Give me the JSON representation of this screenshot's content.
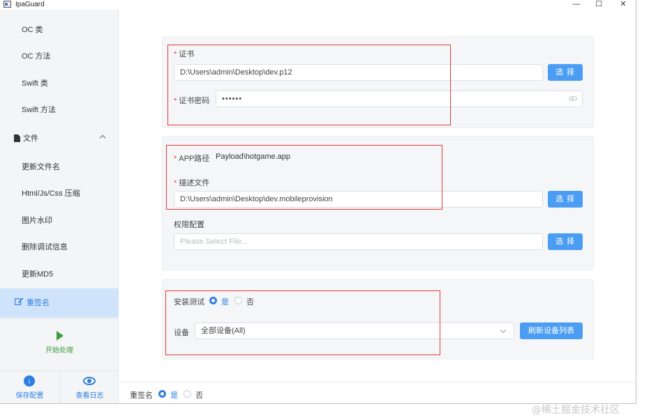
{
  "window": {
    "title": "IpaGuard",
    "minimize": "—",
    "maximize": "☐",
    "close": "✕"
  },
  "sidebar": {
    "items": [
      {
        "label": "OC 类"
      },
      {
        "label": "OC 方法"
      },
      {
        "label": "Swift 类"
      },
      {
        "label": "Swift 方法"
      }
    ],
    "file_section": {
      "label": "文件"
    },
    "file_items": [
      {
        "label": "更新文件名"
      },
      {
        "label": "Html/Js/Css 压缩"
      },
      {
        "label": "图片水印"
      },
      {
        "label": "删除调试信息"
      },
      {
        "label": "更新MD5"
      }
    ],
    "active_item": {
      "label": "重签名"
    },
    "start_label": "开始处理",
    "save_label": "保存配置",
    "log_label": "查看日志"
  },
  "cert_panel": {
    "cert_label": "证书",
    "cert_value": "D:\\Users\\admin\\Desktop\\dev.p12",
    "select_label": "选 择",
    "password_label": "证书密码",
    "password_value": "••••••"
  },
  "app_panel": {
    "app_path_label": "APP路径",
    "app_path_value": "Payload\\hotgame.app",
    "profile_label": "描述文件",
    "profile_value": "D:\\Users\\admin\\Desktop\\dev.mobileprovision",
    "select_label": "选 择",
    "permission_label": "权限配置",
    "permission_placeholder": "Please Select File...",
    "select_label_2": "选 择"
  },
  "install_panel": {
    "install_label": "安装测试",
    "yes": "是",
    "no": "否",
    "device_label": "设备",
    "device_value": "全部设备(All)",
    "refresh_label": "刷新设备列表"
  },
  "bottombar": {
    "resign_label": "重签名",
    "yes": "是",
    "no": "否"
  },
  "watermark": "@稀土掘金技术社区",
  "colors": {
    "accent": "#2f7fe0",
    "button": "#4a9df3",
    "highlight_box": "#e03a3a",
    "start_green": "#3d9e3d"
  }
}
